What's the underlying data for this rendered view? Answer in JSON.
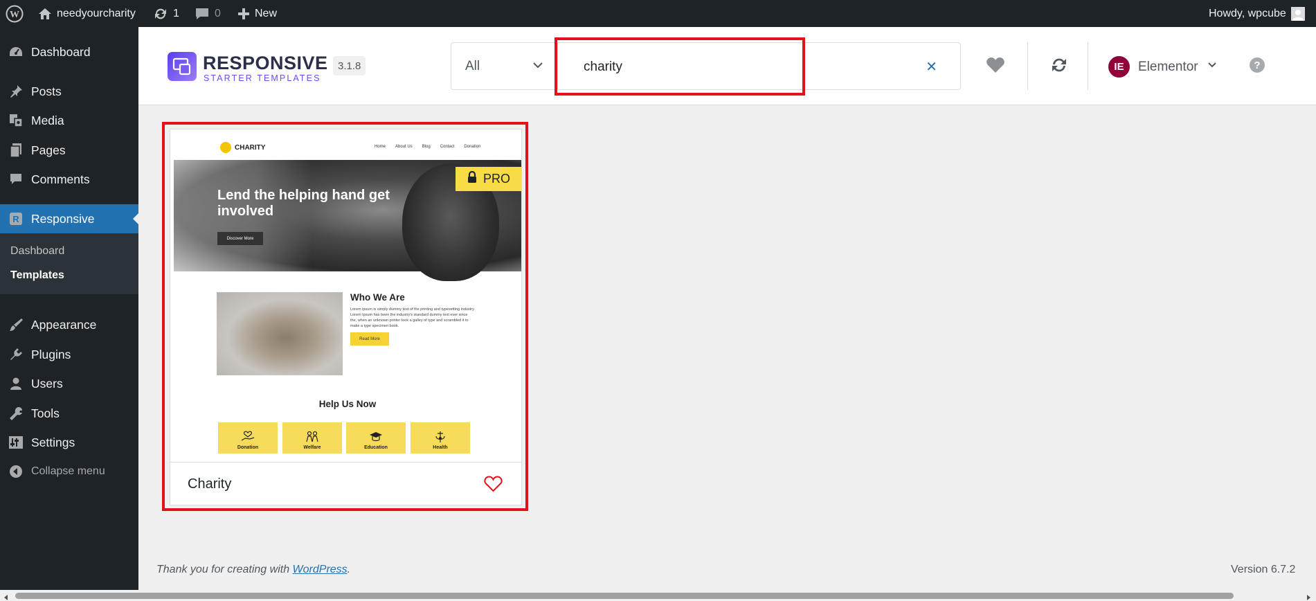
{
  "admin_bar": {
    "site_name": "needyourcharity",
    "updates_count": "1",
    "comments_count": "0",
    "new_label": "New",
    "greeting": "Howdy, wpcube"
  },
  "sidebar": {
    "items": [
      {
        "label": "Dashboard",
        "icon": "dashboard-icon"
      },
      {
        "label": "Posts",
        "icon": "pushpin-icon"
      },
      {
        "label": "Media",
        "icon": "media-icon"
      },
      {
        "label": "Pages",
        "icon": "pages-icon"
      },
      {
        "label": "Comments",
        "icon": "comment-icon"
      },
      {
        "label": "Responsive",
        "icon": "responsive-r-icon"
      },
      {
        "label": "Appearance",
        "icon": "paintbrush-icon"
      },
      {
        "label": "Plugins",
        "icon": "plug-icon"
      },
      {
        "label": "Users",
        "icon": "user-icon"
      },
      {
        "label": "Tools",
        "icon": "wrench-icon"
      },
      {
        "label": "Settings",
        "icon": "settings-sliders-icon"
      }
    ],
    "submenu": [
      "Dashboard",
      "Templates"
    ],
    "collapse_label": "Collapse menu"
  },
  "header": {
    "brand_title": "RESPONSIVE",
    "brand_subtitle": "STARTER TEMPLATES",
    "version": "3.1.8",
    "filter_value": "All",
    "search_value": "charity",
    "builder_label": "Elementor",
    "builder_logo_text": "IE"
  },
  "template": {
    "title": "Charity",
    "badge": "PRO",
    "preview": {
      "logo_text": "CHARITY",
      "nav_links": [
        "Home",
        "About Us",
        "Blog",
        "Contact",
        "Donation"
      ],
      "hero_title": "Lend the helping hand get involved",
      "hero_button": "Discover More",
      "section_title": "Who We Are",
      "section_text": "Lorem ipsum is simply dummy text of the printing and typesetting industry. Lorem Ipsum has been the industry's standard dummy text ever since the, when an unknown printer took a galley of type and scrambled it to make a type specimen book.",
      "read_more": "Read More",
      "help_title": "Help Us Now",
      "help_items": [
        "Donation",
        "Welfare",
        "Education",
        "Health"
      ]
    }
  },
  "footer": {
    "thanks_text": "Thank you for creating with ",
    "wp_link": "WordPress",
    "period": ".",
    "version": "Version 6.7.2"
  },
  "colors": {
    "admin_dark": "#1d2327",
    "accent_blue": "#2271b1",
    "highlight_red": "#e3111a",
    "pro_yellow": "#f7dc48",
    "brand_purple": "#6a4ce8",
    "elementor_red": "#92003b"
  }
}
